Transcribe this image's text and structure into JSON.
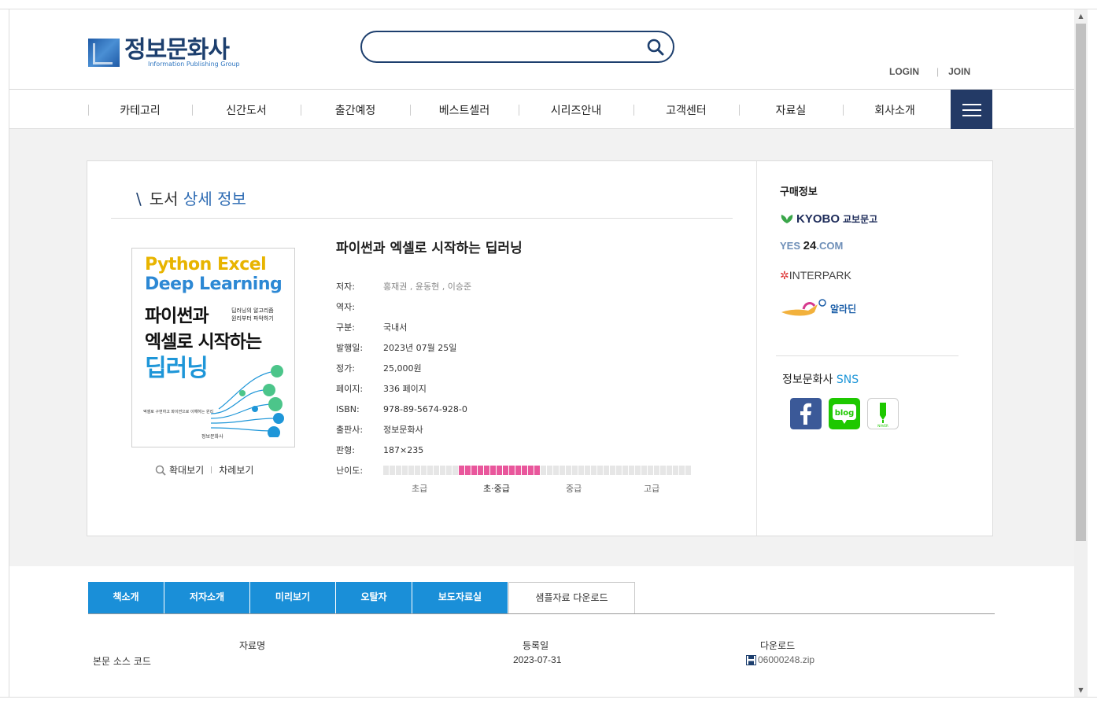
{
  "header": {
    "logo_title": "정보문화사",
    "logo_sub": "Information Publishing Group",
    "search_placeholder": "",
    "login": "LOGIN",
    "join": "JOIN"
  },
  "nav": {
    "items": [
      "카테고리",
      "신간도서",
      "출간예정",
      "베스트셀러",
      "시리즈안내",
      "고객센터",
      "자료실",
      "회사소개"
    ]
  },
  "section": {
    "title_plain": "도서",
    "title_accent": "상세 정보"
  },
  "cover": {
    "eng_line1_a": "Python",
    "eng_line1_b": "Excel",
    "eng_line2": "Deep Learning",
    "kor_line1": "파이썬과",
    "kor_line2": "엑셀로 시작하는",
    "kor_line3": "딥러닝",
    "side_line1": "딥러닝의 알고리즘",
    "side_line2": "원리부터 파악하기",
    "foot": "엑셀로 구현하고 파이썬으로 이해하는 원리",
    "publisher": "정보문화사"
  },
  "cover_links": {
    "zoom": "확대보기",
    "toc": "차례보기"
  },
  "book": {
    "title": "파이썬과 엑셀로 시작하는 딥러닝",
    "rows": [
      {
        "label": "저자:",
        "value": "홍재권 , 윤동현 , 이승준",
        "muted": true
      },
      {
        "label": "역자:",
        "value": ""
      },
      {
        "label": "구분:",
        "value": "국내서"
      },
      {
        "label": "발행일:",
        "value": "2023년 07월 25일"
      },
      {
        "label": "정가:",
        "value": "25,000원"
      },
      {
        "label": "페이지:",
        "value": "336 페이지"
      },
      {
        "label": "ISBN:",
        "value": "978-89-5674-928-0"
      },
      {
        "label": "출판사:",
        "value": "정보문화사"
      },
      {
        "label": "판형:",
        "value": "187×235"
      }
    ],
    "difficulty_label": "난이도:",
    "difficulty_level": 0.25,
    "difficulty_names": [
      "초급",
      "초·중급",
      "중급",
      "고급"
    ],
    "difficulty_active": "초·중급"
  },
  "purchase": {
    "title": "구매정보",
    "kyobo": "KYOBO",
    "kyobo_kor": "교보문고",
    "yes24_a": "YES",
    "yes24_b": "24",
    "yes24_c": ".COM",
    "interpark": "INTERPARK",
    "aladin": "알라딘"
  },
  "sns": {
    "title_a": "정보문화사",
    "title_b": "SNS",
    "blog": "blog",
    "post": "NAVER"
  },
  "tabs": [
    "책소개",
    "저자소개",
    "미리보기",
    "오탈자",
    "보도자료실",
    "샘플자료 다운로드"
  ],
  "downloads": {
    "headers": [
      "자료명",
      "등록일",
      "다운로드"
    ],
    "rows": [
      {
        "name": "본문 소스 코드",
        "date": "2023-07-31",
        "file": "06000248.zip"
      }
    ]
  },
  "colors": {
    "brand_navy": "#1d3f6e",
    "tab_blue": "#1a8fd8",
    "difficulty_pink": "#e9579c",
    "menu_bg": "#233a66"
  }
}
